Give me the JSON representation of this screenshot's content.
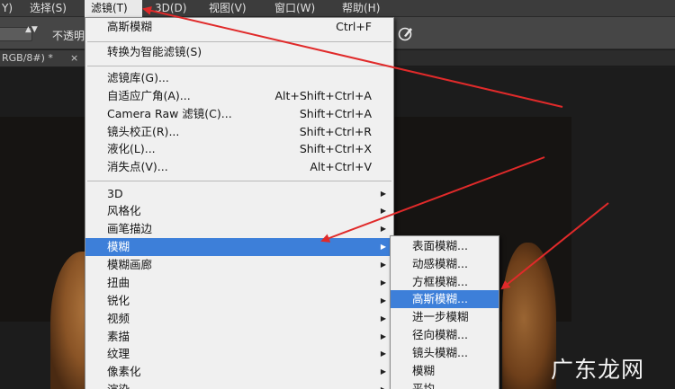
{
  "menubar": {
    "items": [
      {
        "label": "Y)"
      },
      {
        "label": "选择(S)"
      },
      {
        "label": "滤镜(T)"
      },
      {
        "label": "3D(D)"
      },
      {
        "label": "视图(V)"
      },
      {
        "label": "窗口(W)"
      },
      {
        "label": "帮助(H)"
      }
    ],
    "active_index": 2
  },
  "options_bar": {
    "opacity_label": "不透明",
    "preset_arrows": "▲▼"
  },
  "document_tab": {
    "title": "RGB/8#) *",
    "close_glyph": "×"
  },
  "filter_menu": {
    "items": [
      {
        "label": "高斯模糊",
        "shortcut": "Ctrl+F"
      },
      {
        "label": "转换为智能滤镜(S)",
        "shortcut": ""
      },
      {
        "label": "滤镜库(G)...",
        "shortcut": ""
      },
      {
        "label": "自适应广角(A)...",
        "shortcut": "Alt+Shift+Ctrl+A"
      },
      {
        "label": "Camera Raw 滤镜(C)...",
        "shortcut": "Shift+Ctrl+A"
      },
      {
        "label": "镜头校正(R)...",
        "shortcut": "Shift+Ctrl+R"
      },
      {
        "label": "液化(L)...",
        "shortcut": "Shift+Ctrl+X"
      },
      {
        "label": "消失点(V)...",
        "shortcut": "Alt+Ctrl+V"
      },
      {
        "label": "3D",
        "submenu": true
      },
      {
        "label": "风格化",
        "submenu": true
      },
      {
        "label": "画笔描边",
        "submenu": true
      },
      {
        "label": "模糊",
        "submenu": true,
        "highlighted": true
      },
      {
        "label": "模糊画廊",
        "submenu": true
      },
      {
        "label": "扭曲",
        "submenu": true
      },
      {
        "label": "锐化",
        "submenu": true
      },
      {
        "label": "视频",
        "submenu": true
      },
      {
        "label": "素描",
        "submenu": true
      },
      {
        "label": "纹理",
        "submenu": true
      },
      {
        "label": "像素化",
        "submenu": true
      },
      {
        "label": "渲染",
        "submenu": true
      }
    ],
    "submenu_arrow": "▶"
  },
  "blur_submenu": {
    "items": [
      {
        "label": "表面模糊..."
      },
      {
        "label": "动感模糊..."
      },
      {
        "label": "方框模糊..."
      },
      {
        "label": "高斯模糊...",
        "highlighted": true
      },
      {
        "label": "进一步模糊"
      },
      {
        "label": "径向模糊..."
      },
      {
        "label": "镜头模糊..."
      },
      {
        "label": "模糊"
      },
      {
        "label": "平均"
      }
    ]
  },
  "watermark": {
    "text": "广东龙网"
  },
  "colors": {
    "highlight": "#3d7fd9",
    "menu_bg": "#f0f0f0",
    "annotation_arrow": "#e02a2a"
  },
  "icons": {
    "brush": "brush-pressure-icon"
  }
}
